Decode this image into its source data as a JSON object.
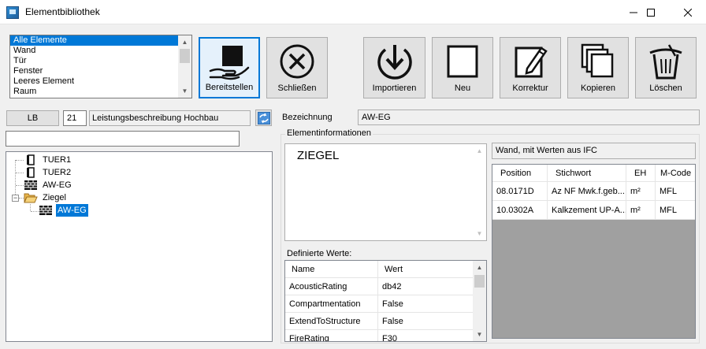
{
  "window": {
    "title": "Elementbibliothek",
    "controls": [
      "minimize-icon",
      "maximize-icon",
      "close-icon"
    ]
  },
  "element_list": {
    "items": [
      "Alle Elemente",
      "Wand",
      "Tür",
      "Fenster",
      "Leeres Element",
      "Raum"
    ],
    "selected": "Alle Elemente"
  },
  "toolbar": {
    "bereitstellen": "Bereitstellen",
    "schliessen": "Schließen",
    "importieren": "Importieren",
    "neu": "Neu",
    "korrektur": "Korrektur",
    "kopieren": "Kopieren",
    "loeschen": "Löschen"
  },
  "lb": {
    "button_label": "LB",
    "number": "21",
    "description": "Leistungsbeschreibung Hochbau"
  },
  "filter": {
    "value": ""
  },
  "tree": {
    "items": [
      {
        "label": "TUER1",
        "icon": "door-icon"
      },
      {
        "label": "TUER2",
        "icon": "door-icon"
      },
      {
        "label": "AW-EG",
        "icon": "brick-wall-icon"
      },
      {
        "label": "Ziegel",
        "icon": "open-folder-icon",
        "expanded": true
      },
      {
        "label": "AW-EG",
        "icon": "brick-wall-icon",
        "selected": true
      }
    ]
  },
  "bezeichnung": {
    "label": "Bezeichnung",
    "value": "AW-EG"
  },
  "elementinformationen": {
    "title": "Elementinformationen",
    "text": "ZIEGEL",
    "ifc_source": "Wand, mit Werten aus IFC"
  },
  "definierte_werte": {
    "label": "Definierte Werte:",
    "columns": [
      "Name",
      "Wert"
    ],
    "rows": [
      {
        "name": "AcousticRating",
        "wert": "db42"
      },
      {
        "name": "Compartmentation",
        "wert": "False"
      },
      {
        "name": "ExtendToStructure",
        "wert": "False"
      },
      {
        "name": "FireRating",
        "wert": "F30"
      }
    ]
  },
  "positions": {
    "columns": [
      "Position",
      "Stichwort",
      "EH",
      "M-Code"
    ],
    "rows": [
      {
        "position": "08.0171D",
        "stichwort": "Az NF Mwk.f.geb...",
        "eh": "m²",
        "mcode": "MFL"
      },
      {
        "position": "10.0302A",
        "stichwort": "Kalkzement UP-A...",
        "eh": "m²",
        "mcode": "MFL"
      }
    ]
  }
}
